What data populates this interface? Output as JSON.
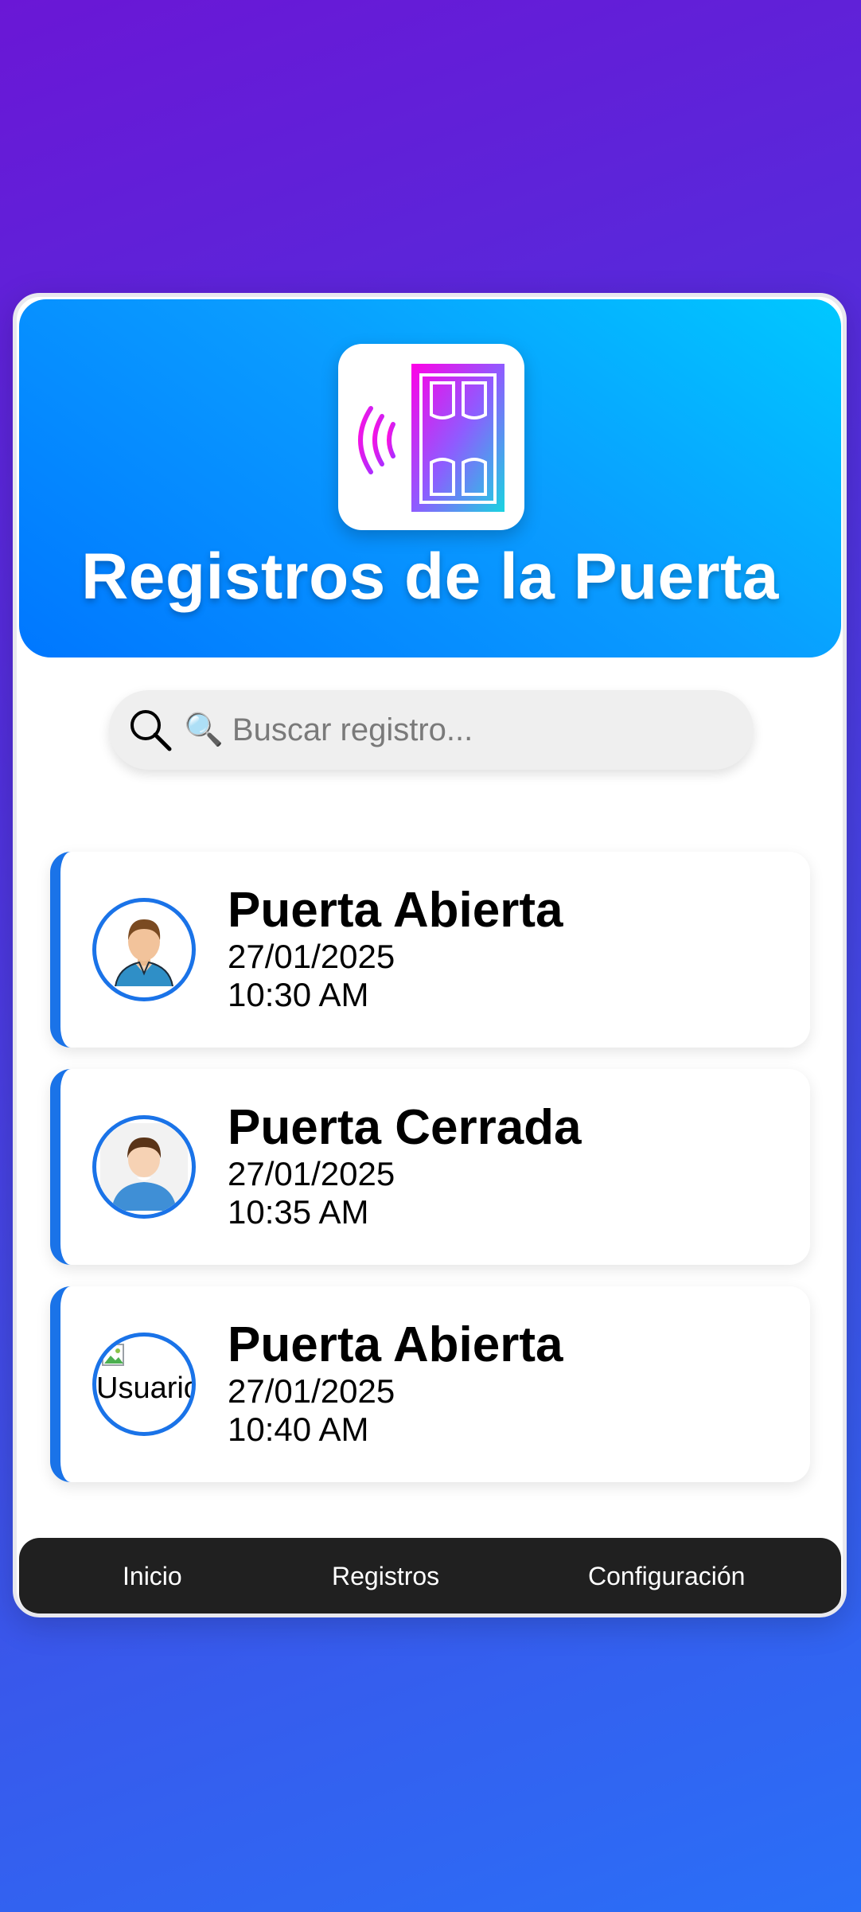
{
  "header": {
    "title": "Registros de la Puerta",
    "logo_icon": "smart-door-icon",
    "gradient": [
      "#00c8ff",
      "#0077ff"
    ]
  },
  "search": {
    "placeholder": "🔍 Buscar registro...",
    "value": ""
  },
  "records": [
    {
      "title": "Puerta Abierta",
      "date": "27/01/2025",
      "time": "10:30 AM",
      "avatar": "man-avatar-icon"
    },
    {
      "title": "Puerta Cerrada",
      "date": "27/01/2025",
      "time": "10:35 AM",
      "avatar": "user-avatar-icon"
    },
    {
      "title": "Puerta Abierta",
      "date": "27/01/2025",
      "time": "10:40 AM",
      "avatar": "broken-image-icon",
      "avatar_alt": "Usuario"
    }
  ],
  "nav": {
    "items": [
      {
        "label": "Inicio"
      },
      {
        "label": "Registros"
      },
      {
        "label": "Configuración"
      }
    ]
  },
  "colors": {
    "accent": "#1a73e8",
    "nav_bg": "#202020"
  }
}
